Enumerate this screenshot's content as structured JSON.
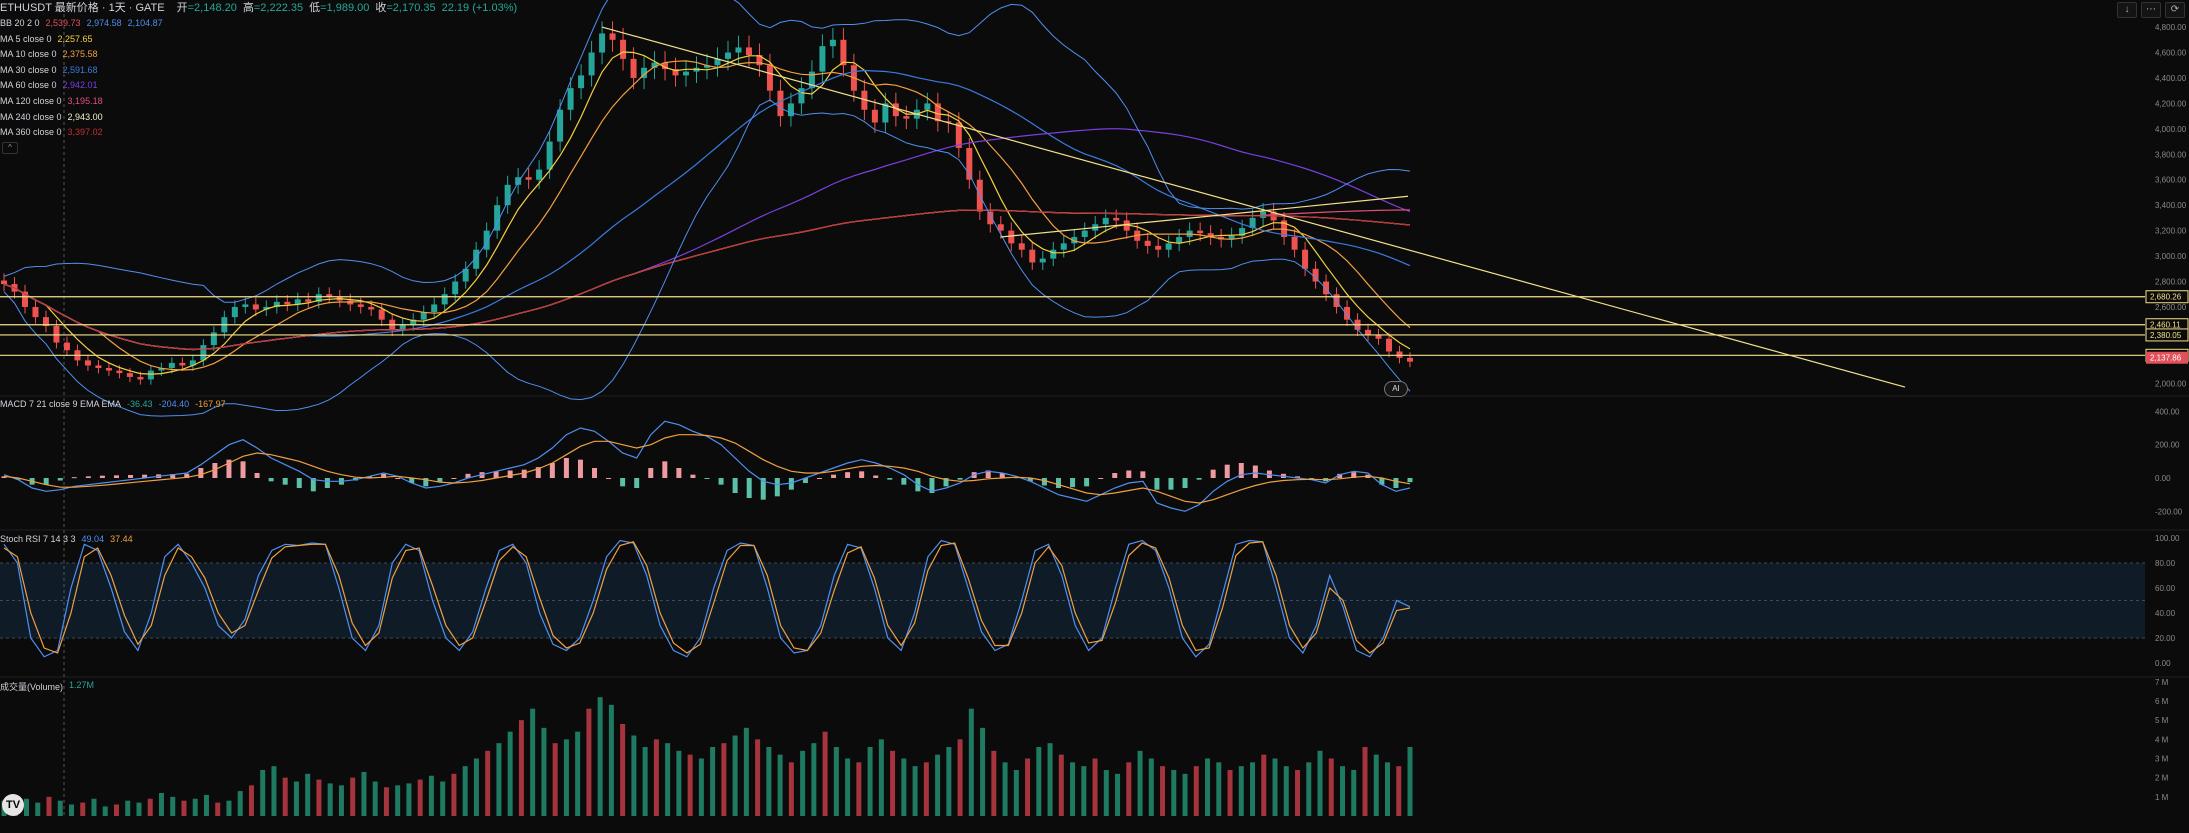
{
  "legend": {
    "title": "ETHUSDT 最新价格 · 1天 · GATE",
    "ohlc": {
      "o_label": "开",
      "o": "=2,148.20",
      "h_label": "高",
      "h": "=2,222.35",
      "l_label": "低",
      "l": "=1,989.00",
      "c_label": "收",
      "c": "=2,170.35",
      "chg": "22.19 (+1.03%)"
    },
    "rows": [
      {
        "label": "BB 20 2 0",
        "values": [
          "2,539.73",
          "2,974.58",
          "2,104.87"
        ],
        "colors": [
          "#e0515a",
          "#4f8ff0",
          "#4f8ff0"
        ]
      },
      {
        "label": "MA 5 close 0",
        "values": [
          "2,257.65"
        ],
        "colors": [
          "#f4d03f"
        ]
      },
      {
        "label": "MA 10 close 0",
        "values": [
          "2,375.58"
        ],
        "colors": [
          "#f0a040"
        ]
      },
      {
        "label": "MA 30 close 0",
        "values": [
          "2,591.68"
        ],
        "colors": [
          "#3a7be0"
        ]
      },
      {
        "label": "MA 60 close 0",
        "values": [
          "2,942.01"
        ],
        "colors": [
          "#7b3fe0"
        ]
      },
      {
        "label": "MA 120 close 0",
        "values": [
          "3,195.18"
        ],
        "colors": [
          "#e0507a"
        ]
      },
      {
        "label": "MA 240 close 0",
        "values": [
          "2,943.00"
        ],
        "colors": [
          "#f5f0c8"
        ]
      },
      {
        "label": "MA 360 close 0",
        "values": [
          "3,397.02"
        ],
        "colors": [
          "#c03030"
        ]
      }
    ]
  },
  "macd_label": {
    "label": "MACD 7 21 close 9 EMA EMA",
    "values": [
      "-36.43",
      "-204.40",
      "-167.97"
    ],
    "colors": [
      "#26a69a",
      "#4f8ff0",
      "#f0a040"
    ]
  },
  "stoch_label": {
    "label": "Stoch RSI 7 14 3 3",
    "values": [
      "49.04",
      "37.44"
    ],
    "colors": [
      "#4f8ff0",
      "#f0a040"
    ]
  },
  "volume_label": {
    "label": "成交量(Volume)",
    "values": [
      "1.27M"
    ],
    "colors": [
      "#26a69a"
    ]
  },
  "buttons": {
    "down": "↓",
    "more": "⋯",
    "reset": "⟳",
    "collapse": "^",
    "ai": "AI",
    "logo": "TV"
  },
  "price_tags": {
    "current": "2,137.86",
    "current_color": "#e0515a",
    "levels": [
      "2,680.26",
      "2,460.11",
      "2,380.05",
      "2,219.95"
    ]
  },
  "chart_data": [
    {
      "type": "candlestick",
      "title": "ETHUSDT 最新价格 · 1天 · GATE",
      "ylabel": "",
      "ylim": [
        1900,
        4950
      ],
      "yticks": [
        "2,000.00",
        "2,200.00",
        "2,400.00",
        "2,600.00",
        "2,800.00",
        "3,000.00",
        "3,200.00",
        "3,400.00",
        "3,600.00",
        "3,800.00",
        "4,000.00",
        "4,200.00",
        "4,400.00",
        "4,600.00",
        "4,800.00"
      ],
      "horizontal_levels": [
        2680.26,
        2460.11,
        2380.05,
        2219.95
      ],
      "current_price": 2137.86,
      "series": [
        {
          "name": "price",
          "values": [
            2780,
            2720,
            2600,
            2520,
            2450,
            2320,
            2260,
            2180,
            2140,
            2120,
            2100,
            2080,
            2050,
            2030,
            2100,
            2120,
            2160,
            2140,
            2180,
            2300,
            2400,
            2520,
            2600,
            2620,
            2580,
            2600,
            2640,
            2620,
            2660,
            2640,
            2700,
            2680,
            2650,
            2620,
            2600,
            2580,
            2500,
            2420,
            2460,
            2500,
            2560,
            2620,
            2700,
            2800,
            2900,
            3050,
            3200,
            3400,
            3560,
            3620,
            3600,
            3680,
            3900,
            4150,
            4320,
            4420,
            4600,
            4750,
            4700,
            4550,
            4400,
            4480,
            4520,
            4470,
            4420,
            4450,
            4480,
            4500,
            4550,
            4600,
            4640,
            4580,
            4500,
            4300,
            4100,
            4200,
            4320,
            4450,
            4650,
            4700,
            4500,
            4300,
            4150,
            4050,
            4200,
            4100,
            4080,
            4150,
            4200,
            4060,
            4050,
            3850,
            3600,
            3350,
            3250,
            3200,
            3100,
            3050,
            2950,
            2980,
            3050,
            3100,
            3150,
            3200,
            3250,
            3300,
            3280,
            3200,
            3120,
            3080,
            3050,
            3100,
            3150,
            3200,
            3180,
            3150,
            3130,
            3160,
            3220,
            3300,
            3350,
            3280,
            3150,
            3050,
            2900,
            2800,
            2700,
            2600,
            2500,
            2420,
            2380,
            2350,
            2250,
            2200,
            2170
          ]
        }
      ]
    },
    {
      "type": "line",
      "title": "MACD 7 21 close 9 EMA EMA",
      "ylim": [
        -300,
        480
      ],
      "yticks": [
        "400.00",
        "200.00",
        "0.00",
        "-200.00"
      ],
      "series": [
        {
          "name": "MACD",
          "values": [
            20,
            -10,
            -60,
            -80,
            -70,
            -50,
            -40,
            -30,
            -20,
            -10,
            0,
            10,
            20,
            30,
            80,
            140,
            200,
            230,
            180,
            120,
            80,
            40,
            -10,
            -20,
            -20,
            -10,
            10,
            30,
            10,
            -30,
            -60,
            -50,
            -30,
            0,
            20,
            40,
            60,
            80,
            120,
            180,
            260,
            300,
            280,
            220,
            150,
            120,
            260,
            340,
            320,
            280,
            250,
            200,
            120,
            40,
            -20,
            -40,
            -30,
            0,
            30,
            60,
            90,
            110,
            90,
            60,
            20,
            -40,
            -80,
            -60,
            -30,
            20,
            40,
            30,
            10,
            -20,
            -60,
            -100,
            -120,
            -140,
            -100,
            -60,
            -30,
            -20,
            -150,
            -180,
            -200,
            -160,
            -80,
            -20,
            20,
            30,
            20,
            10,
            0,
            -10,
            -30,
            20,
            40,
            30,
            -40,
            -80,
            -60
          ]
        },
        {
          "name": "Signal",
          "values": [
            10,
            0,
            -20,
            -40,
            -55,
            -55,
            -50,
            -44,
            -36,
            -28,
            -20,
            -12,
            -4,
            4,
            20,
            50,
            90,
            130,
            150,
            140,
            120,
            100,
            70,
            40,
            20,
            5,
            0,
            5,
            10,
            0,
            -10,
            -25,
            -30,
            -25,
            -15,
            0,
            15,
            30,
            55,
            90,
            140,
            190,
            220,
            220,
            200,
            180,
            200,
            240,
            260,
            260,
            255,
            240,
            210,
            160,
            110,
            70,
            40,
            30,
            30,
            40,
            55,
            70,
            75,
            70,
            60,
            40,
            10,
            -10,
            -20,
            -15,
            -5,
            0,
            5,
            0,
            -15,
            -40,
            -65,
            -90,
            -100,
            -90,
            -75,
            -60,
            -80,
            -110,
            -140,
            -150,
            -130,
            -100,
            -70,
            -45,
            -25,
            -15,
            -10,
            -8,
            -10,
            -5,
            5,
            10,
            0,
            -20,
            -35
          ]
        },
        {
          "name": "Histogram",
          "values": [
            10,
            -10,
            -40,
            -40,
            -15,
            5,
            10,
            14,
            16,
            18,
            20,
            22,
            24,
            26,
            60,
            90,
            110,
            100,
            30,
            -20,
            -40,
            -60,
            -80,
            -60,
            -40,
            -15,
            10,
            25,
            0,
            -30,
            -50,
            -25,
            0,
            25,
            35,
            40,
            45,
            50,
            65,
            90,
            120,
            110,
            60,
            0,
            -50,
            -60,
            60,
            100,
            60,
            20,
            -5,
            -40,
            -90,
            -120,
            -130,
            -110,
            -70,
            -30,
            0,
            20,
            35,
            40,
            15,
            -10,
            -40,
            -80,
            -90,
            -50,
            -10,
            35,
            45,
            30,
            5,
            -20,
            -45,
            -60,
            -55,
            -50,
            0,
            30,
            45,
            40,
            -70,
            -70,
            -60,
            -10,
            50,
            80,
            90,
            75,
            45,
            25,
            10,
            -2,
            -20,
            25,
            35,
            20,
            -40,
            -60,
            -25
          ]
        }
      ]
    },
    {
      "type": "line",
      "title": "Stoch RSI 7 14 3 3",
      "ylim": [
        0,
        100
      ],
      "yticks": [
        "100.00",
        "80.00",
        "60.00",
        "40.00",
        "20.00",
        "0.00"
      ],
      "series": [
        {
          "name": "K",
          "values": [
            95,
            80,
            20,
            5,
            10,
            60,
            95,
            90,
            60,
            25,
            10,
            40,
            85,
            95,
            80,
            60,
            30,
            20,
            35,
            70,
            90,
            95,
            94,
            96,
            95,
            60,
            20,
            10,
            30,
            80,
            95,
            90,
            50,
            20,
            10,
            25,
            60,
            90,
            95,
            80,
            40,
            15,
            10,
            20,
            50,
            85,
            98,
            96,
            70,
            30,
            10,
            5,
            20,
            60,
            90,
            96,
            94,
            60,
            20,
            8,
            10,
            30,
            70,
            95,
            92,
            60,
            20,
            10,
            40,
            85,
            98,
            95,
            60,
            25,
            10,
            15,
            50,
            90,
            95,
            70,
            30,
            10,
            20,
            60,
            95,
            98,
            90,
            60,
            20,
            5,
            15,
            55,
            95,
            98,
            97,
            60,
            20,
            8,
            30,
            70,
            45,
            10,
            5,
            20,
            50,
            45
          ]
        },
        {
          "name": "D",
          "values": [
            92,
            85,
            40,
            12,
            8,
            40,
            85,
            92,
            70,
            38,
            15,
            30,
            70,
            92,
            85,
            68,
            40,
            24,
            30,
            58,
            84,
            93,
            94,
            95,
            95,
            70,
            32,
            14,
            24,
            68,
            90,
            92,
            62,
            30,
            14,
            20,
            50,
            82,
            93,
            85,
            52,
            22,
            12,
            16,
            40,
            75,
            94,
            97,
            78,
            40,
            16,
            8,
            15,
            48,
            82,
            94,
            94,
            70,
            30,
            12,
            10,
            24,
            58,
            88,
            93,
            68,
            30,
            14,
            32,
            74,
            94,
            96,
            68,
            34,
            14,
            14,
            40,
            80,
            93,
            78,
            40,
            16,
            18,
            48,
            86,
            96,
            92,
            68,
            30,
            10,
            12,
            44,
            86,
            96,
            97,
            70,
            30,
            12,
            24,
            60,
            50,
            18,
            8,
            16,
            42,
            44
          ]
        }
      ]
    },
    {
      "type": "bar",
      "title": "成交量(Volume)",
      "ylim": [
        0,
        7.2
      ],
      "yticks": [
        "7 M",
        "6 M",
        "5 M",
        "4 M",
        "3 M",
        "2 M",
        "1 M"
      ],
      "series": [
        {
          "name": "Volume",
          "values": [
            0.8,
            0.6,
            0.9,
            0.7,
            1.0,
            0.8,
            0.6,
            0.7,
            0.9,
            0.5,
            0.6,
            0.8,
            0.7,
            0.9,
            1.2,
            1.0,
            0.8,
            0.9,
            1.1,
            0.7,
            0.8,
            1.3,
            1.6,
            2.4,
            2.6,
            2.0,
            1.8,
            2.2,
            1.9,
            1.7,
            1.6,
            2.0,
            2.3,
            1.8,
            1.5,
            1.6,
            1.7,
            1.9,
            2.1,
            1.8,
            2.2,
            2.6,
            3.0,
            3.4,
            3.8,
            4.4,
            5.0,
            5.6,
            4.6,
            3.8,
            4.0,
            4.4,
            5.6,
            6.2,
            5.8,
            4.8,
            4.2,
            3.6,
            4.0,
            3.8,
            3.4,
            3.2,
            3.0,
            3.6,
            3.8,
            4.2,
            4.6,
            4.0,
            3.6,
            3.2,
            2.8,
            3.4,
            3.8,
            4.4,
            3.6,
            3.0,
            2.8,
            3.6,
            4.0,
            3.4,
            3.0,
            2.6,
            2.8,
            3.2,
            3.6,
            4.0,
            5.6,
            4.6,
            3.4,
            2.8,
            2.4,
            3.0,
            3.6,
            3.8,
            3.2,
            2.8,
            2.6,
            3.0,
            2.4,
            2.2,
            2.8,
            3.4,
            3.0,
            2.6,
            2.4,
            2.2,
            2.6,
            3.0,
            2.8,
            2.4,
            2.6,
            2.8,
            3.2,
            3.0,
            2.6,
            2.4,
            2.8,
            3.4,
            3.0,
            2.6,
            2.4,
            3.6,
            3.2,
            2.8,
            2.6,
            3.6
          ]
        }
      ]
    }
  ]
}
